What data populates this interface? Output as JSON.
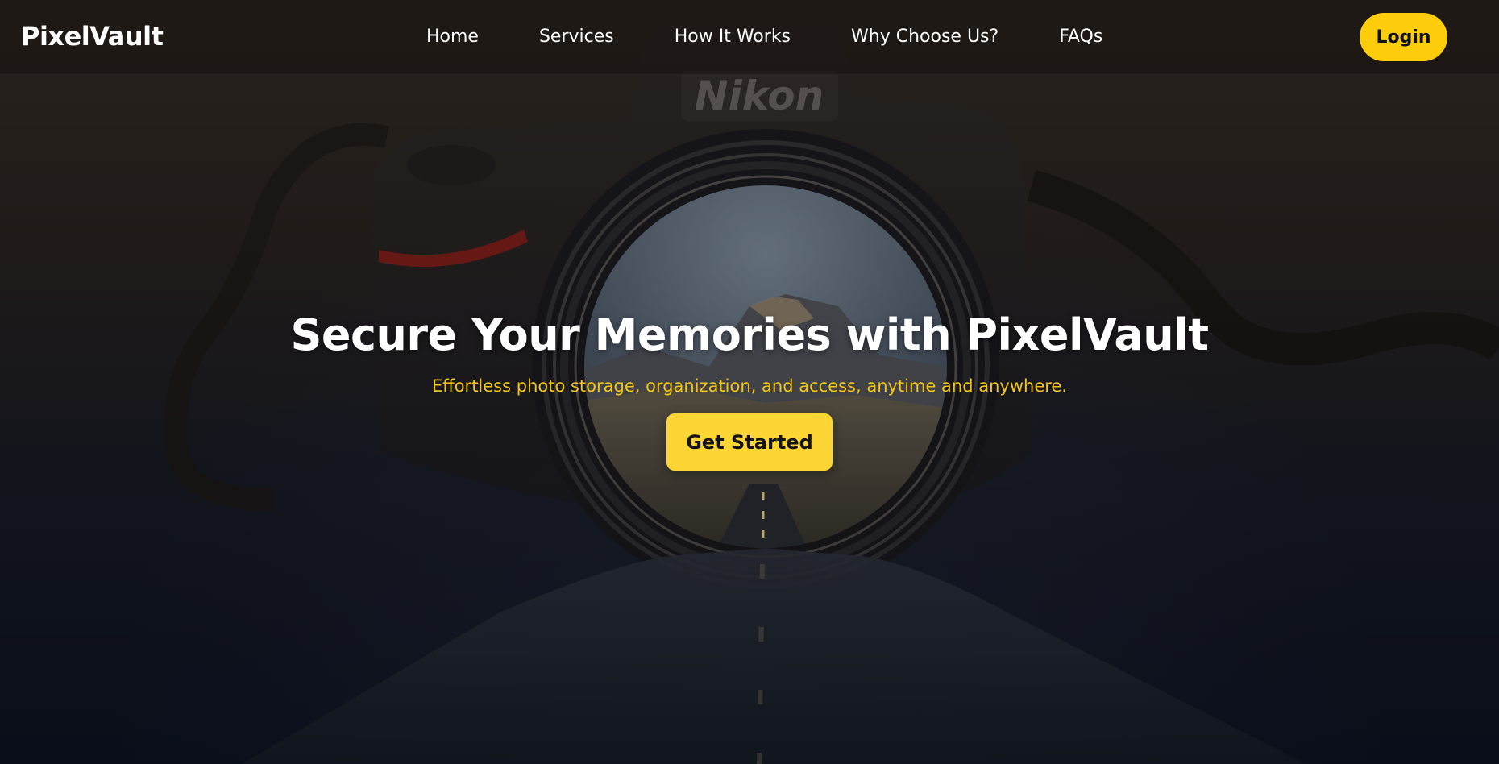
{
  "brand": {
    "name": "PixelVault"
  },
  "nav": {
    "items": [
      {
        "label": "Home"
      },
      {
        "label": "Services"
      },
      {
        "label": "How It Works"
      },
      {
        "label": "Why Choose Us?"
      },
      {
        "label": "FAQs"
      }
    ],
    "login_label": "Login"
  },
  "hero": {
    "title": "Secure Your Memories with PixelVault",
    "subtitle": "Effortless photo storage, organization, and access, anytime and anywhere.",
    "cta_label": "Get Started",
    "background_description_icon": "camera-lens-road-photo"
  },
  "colors": {
    "accent": "#fdcd0b",
    "subtitle": "#f3c516",
    "text": "#ffffff"
  }
}
